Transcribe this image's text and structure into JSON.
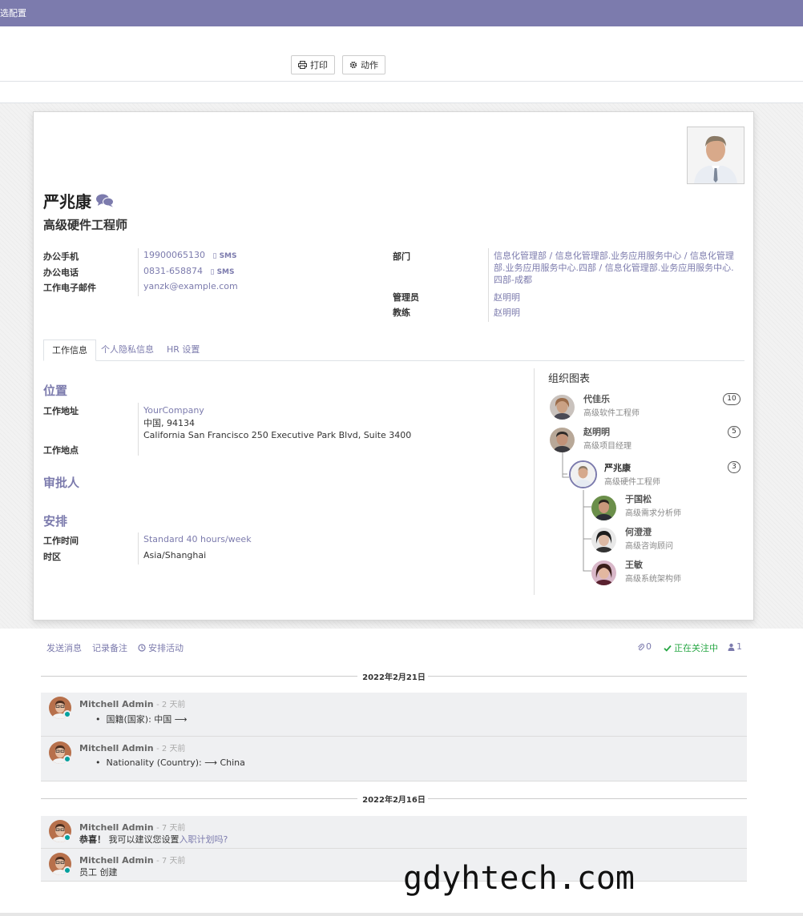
{
  "topbar": {
    "title": "选配置"
  },
  "toolbar": {
    "print_label": "打印",
    "action_label": "动作"
  },
  "employee": {
    "name": "严兆康",
    "job_title": "高级硬件工程师",
    "mobile_label": "办公手机",
    "mobile": "19900065130",
    "phone_label": "办公电话",
    "phone": "0831-658874",
    "email_label": "工作电子邮件",
    "email": "yanzk@example.com",
    "sms_label": "SMS",
    "dept_label": "部门",
    "dept_line1": "信息化管理部 / 信息化管理部.业务应用服务中心 / 信息化管理",
    "dept_line2": "部.业务应用服务中心.四部 / 信息化管理部.业务应用服务中心.",
    "dept_line3": "四部-成都",
    "manager_label": "管理员",
    "manager": "赵明明",
    "coach_label": "教练",
    "coach": "赵明明"
  },
  "tabs": [
    {
      "label": "工作信息"
    },
    {
      "label": "个人隐私信息"
    },
    {
      "label": "HR 设置"
    }
  ],
  "work": {
    "location_title": "位置",
    "address_label": "工作地址",
    "company": "YourCompany",
    "address_line1": "中国, 94134",
    "address_line2": "California San Francisco 250 Executive Park Blvd, Suite 3400",
    "place_label": "工作地点",
    "approver_title": "审批人",
    "schedule_title": "安排",
    "hours_label": "工作时间",
    "hours": "Standard 40 hours/week",
    "tz_label": "时区",
    "tz": "Asia/Shanghai"
  },
  "org": {
    "title": "组织图表",
    "people": [
      {
        "name": "代佳乐",
        "job": "高级软件工程师",
        "count": "10"
      },
      {
        "name": "赵明明",
        "job": "高级项目经理",
        "count": "5"
      },
      {
        "name": "严兆康",
        "job": "高级硬件工程师",
        "count": "3"
      },
      {
        "name": "于国松",
        "job": "高级需求分析师"
      },
      {
        "name": "何澄澄",
        "job": "高级咨询顾问"
      },
      {
        "name": "王敏",
        "job": "高级系统架构师"
      }
    ]
  },
  "chatter": {
    "send_label": "发送消息",
    "note_label": "记录备注",
    "activity_label": "安排活动",
    "attach_count": "0",
    "following_label": "正在关注中",
    "followers": "1",
    "date1": "2022年2月21日",
    "date2": "2022年2月16日",
    "messages": [
      {
        "author": "Mitchell Admin",
        "when": "- 2 天前",
        "body": "国籍(国家): 中国 ⟶"
      },
      {
        "author": "Mitchell Admin",
        "when": "- 2 天前",
        "body": "Nationality (Country): ⟶ China"
      },
      {
        "author": "Mitchell Admin",
        "when": "- 7 天前",
        "bold": "恭喜！",
        "body": "我可以建议您设置",
        "link": "入职计划吗?"
      },
      {
        "author": "Mitchell Admin",
        "when": "- 7 天前",
        "body": "员工 创建"
      }
    ]
  },
  "watermark": "gdyhtech.com",
  "colors": {
    "brand": "#7c7bad",
    "following": "#28a745"
  }
}
